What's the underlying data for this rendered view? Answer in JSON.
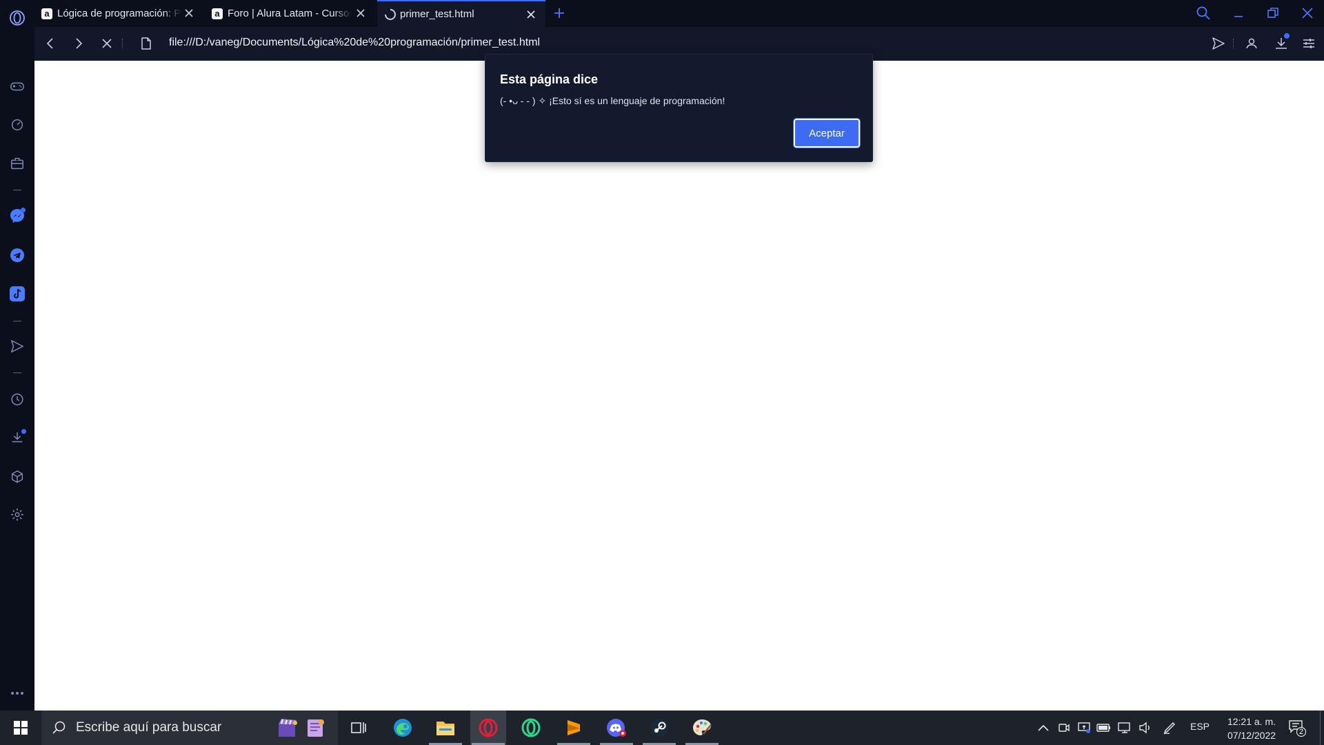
{
  "tabs": [
    {
      "title": "Lógica de programación: Primeros pasos",
      "favicon": "alura-a-icon",
      "active": false
    },
    {
      "title": "Foro | Alura Latam - Cursos",
      "favicon": "alura-a-icon",
      "active": false
    },
    {
      "title": "primer_test.html",
      "favicon": "loading-spinner-icon",
      "active": true
    }
  ],
  "address_bar": {
    "url": "file:///D:/vaneg/Documents/Lógica%20de%20programación/primer_test.html"
  },
  "dialog": {
    "title": "Esta página dice",
    "message": "(- •ᴗ - - ) ✧ ¡Esto sí es un lenguaje de programación!",
    "button_label": "Aceptar"
  },
  "taskbar": {
    "search_placeholder": "Escribe aquí para buscar",
    "language": "ESP",
    "time": "12:21 a. m.",
    "date": "07/12/2022",
    "notification_count": "2"
  },
  "colors": {
    "accent": "#3d6cff",
    "browser_bg": "#0b0f1b",
    "toolbar_bg": "#12182a",
    "taskbar_bg": "#1e232b"
  }
}
